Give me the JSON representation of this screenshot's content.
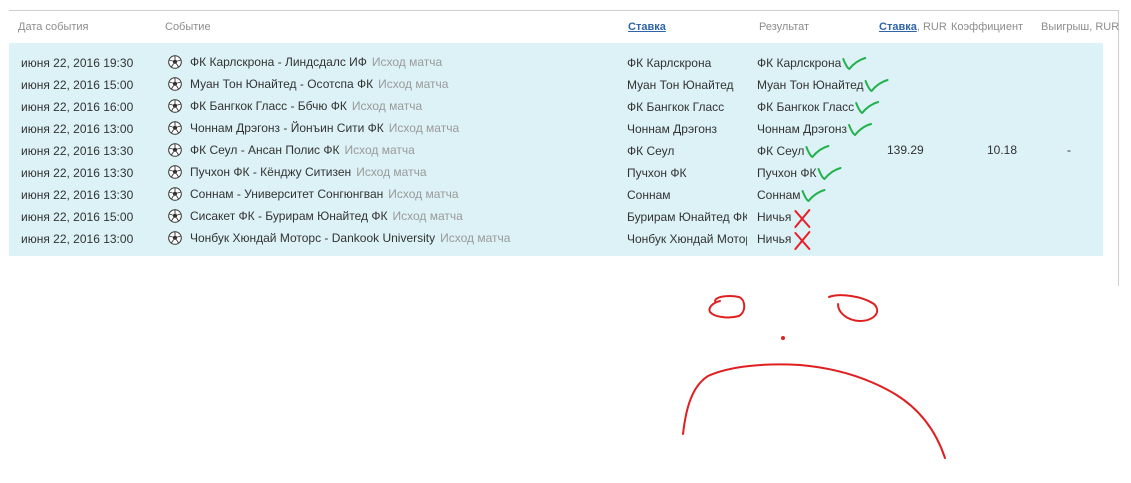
{
  "headers": {
    "date": "Дата события",
    "event": "Событие",
    "stake": "Ставка",
    "result": "Результат",
    "amount_link": "Ставка",
    "amount_suffix": ", RUR",
    "coef": "Коэффициент",
    "win": "Выигрыш, RUR"
  },
  "rows": [
    {
      "date": "июня 22, 2016 19:30",
      "event": "ФК Карлскрона - Линдсдалс ИФ",
      "type": "Исход матча",
      "stake": "ФК Карлскрона",
      "result": "ФК Карлскрона",
      "mark": "check"
    },
    {
      "date": "июня 22, 2016 15:00",
      "event": "Муан Тон Юнайтед - Осотспа ФК",
      "type": "Исход матча",
      "stake": "Муан Тон Юнайтед",
      "result": "Муан Тон Юнайтед",
      "mark": "check"
    },
    {
      "date": "июня 22, 2016 16:00",
      "event": "ФК Бангкок Гласс - Ббчю ФК",
      "type": "Исход матча",
      "stake": "ФК Бангкок Гласс",
      "result": "ФК Бангкок Гласс",
      "mark": "check"
    },
    {
      "date": "июня 22, 2016 13:00",
      "event": "Чоннам Дрэгонз - Йонъин Сити ФК",
      "type": "Исход матча",
      "stake": "Чоннам Дрэгонз",
      "result": "Чоннам Дрэгонз",
      "mark": "check"
    },
    {
      "date": "июня 22, 2016 13:30",
      "event": "ФК Сеул - Ансан Полис ФК",
      "type": "Исход матча",
      "stake": "ФК Сеул",
      "result": "ФК Сеул",
      "mark": "check"
    },
    {
      "date": "июня 22, 2016 13:30",
      "event": "Пучхон ФК - Кёнджу Ситизен",
      "type": "Исход матча",
      "stake": "Пучхон ФК",
      "result": "Пучхон ФК",
      "mark": "check"
    },
    {
      "date": "июня 22, 2016 13:30",
      "event": "Соннам - Университет Сонгюнгван",
      "type": "Исход матча",
      "stake": "Соннам",
      "result": "Соннам",
      "mark": "check"
    },
    {
      "date": "июня 22, 2016 15:00",
      "event": "Сисакет ФК - Бурирам Юнайтед ФК",
      "type": "Исход матча",
      "stake": "Бурирам Юнайтед ФК",
      "result": "Ничья",
      "mark": "cross"
    },
    {
      "date": "июня 22, 2016 13:00",
      "event": "Чонбук Хюндай Моторс - Dankook University",
      "type": "Исход матча",
      "stake": "Чонбук Хюндай Моторс",
      "result": "Ничья",
      "mark": "cross"
    }
  ],
  "summary": {
    "amount": "139.29",
    "coef": "10.18",
    "win": "-"
  },
  "colors": {
    "check": "#22b14c",
    "cross": "#ed1c24",
    "doodle": "#e02020",
    "box": "#dcf2f7",
    "link": "#2f64a7"
  },
  "icons": {
    "row_icon": "soccer-ball-icon",
    "mark_ok": "check-mark-icon",
    "mark_fail": "cross-mark-icon"
  }
}
